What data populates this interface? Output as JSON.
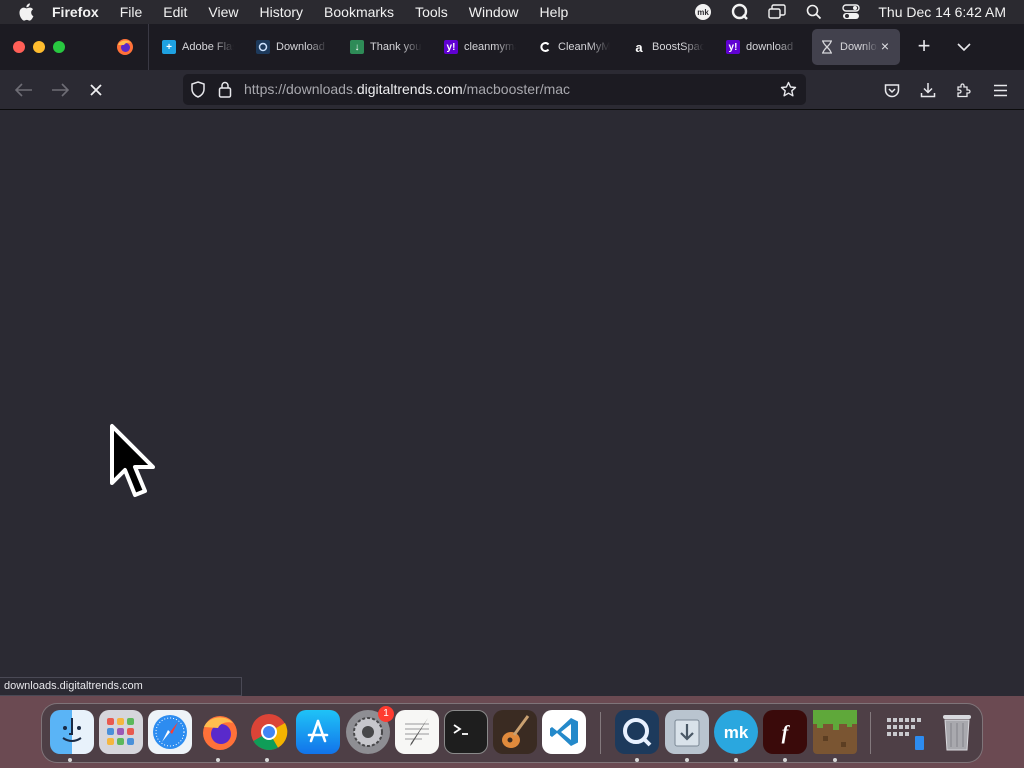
{
  "menubar": {
    "app_name": "Firefox",
    "menus": [
      "File",
      "Edit",
      "View",
      "History",
      "Bookmarks",
      "Tools",
      "Window",
      "Help"
    ],
    "status_icons": [
      "mk-icon",
      "quicktime-icon",
      "screen-mirroring-icon",
      "spotlight-icon",
      "control-center-icon"
    ],
    "clock": "Thu Dec 14  6:42 AM"
  },
  "tabs": [
    {
      "title": "Adobe Flash",
      "icon": "adobe-icon",
      "color": "#1ea1e1"
    },
    {
      "title": "Download",
      "icon": "quicktime-icon",
      "color": "#1d3a5c"
    },
    {
      "title": "Thank you",
      "icon": "download-green-icon",
      "color": "#2e8b57"
    },
    {
      "title": "cleanmymac",
      "icon": "yahoo-icon",
      "color": "#6001d2"
    },
    {
      "title": "CleanMyMac",
      "icon": "cleanmymac-icon",
      "color": "#1c1b22"
    },
    {
      "title": "BoostSpace",
      "icon": "amazon-icon",
      "color": "#1c1b22"
    },
    {
      "title": "download",
      "icon": "yahoo-icon",
      "color": "#6001d2"
    },
    {
      "title": "Downloads",
      "icon": "hourglass-icon",
      "color": "#42414d",
      "active": true
    }
  ],
  "navbar": {
    "url_prefix": "https://downloads.",
    "url_host": "digitaltrends.com",
    "url_path": "/macbooster/mac"
  },
  "status": {
    "text": "downloads.digitaltrends.com"
  },
  "dock": {
    "items": [
      {
        "name": "finder",
        "running": true
      },
      {
        "name": "launchpad",
        "running": false
      },
      {
        "name": "safari",
        "running": false
      },
      {
        "name": "firefox",
        "running": true
      },
      {
        "name": "chrome",
        "running": true
      },
      {
        "name": "app-store",
        "running": false
      },
      {
        "name": "system-settings",
        "running": false,
        "badge": "1"
      },
      {
        "name": "textedit",
        "running": false
      },
      {
        "name": "terminal",
        "running": false
      },
      {
        "name": "garageband",
        "running": false
      },
      {
        "name": "vscode",
        "running": false
      },
      {
        "name": "quicktime",
        "running": true
      },
      {
        "name": "installer",
        "running": true
      },
      {
        "name": "macupdate",
        "running": true
      },
      {
        "name": "flash-player",
        "running": true
      },
      {
        "name": "minecraft",
        "running": true
      },
      {
        "name": "downloads-stack",
        "running": false
      },
      {
        "name": "trash",
        "running": false
      }
    ]
  },
  "colors": {
    "toolbar": "#2b2a33",
    "tabstrip": "#1c1b22",
    "active_tab": "#42414d",
    "urlbar": "#1c1b22",
    "menubar": "#2b2a30"
  }
}
